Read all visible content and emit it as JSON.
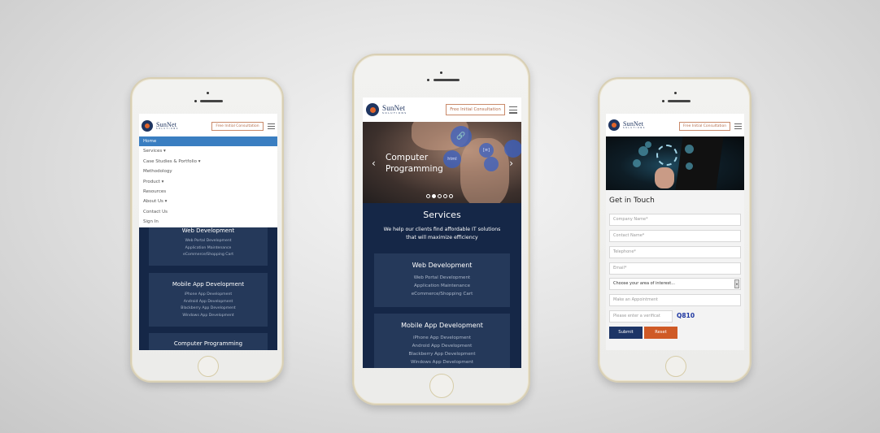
{
  "brand": {
    "name": "SunNet",
    "subtitle": "SOLUTIONS",
    "cta_label": "Free Initial Consultation",
    "colors": {
      "navy": "#152747",
      "card": "#25395a",
      "orange": "#cf5a26",
      "menu_active": "#3a7ec1"
    }
  },
  "left_phone": {
    "menu": [
      {
        "label": "Home",
        "active": true
      },
      {
        "label": "Services ▾"
      },
      {
        "label": "Case Studies & Portfolio ▾"
      },
      {
        "label": "Methodology"
      },
      {
        "label": "Product ▾"
      },
      {
        "label": "Resources"
      },
      {
        "label": "About Us ▾"
      },
      {
        "label": "Contact Us"
      },
      {
        "label": "Sign In"
      }
    ],
    "cards": [
      {
        "title": "Web Development",
        "lines": [
          "Web Portal Development",
          "Application Maintenance",
          "eCommerce/Shopping Cart"
        ]
      },
      {
        "title": "Mobile App Development",
        "lines": [
          "iPhone App Development",
          "Android App Development",
          "Blackberry App Development",
          "Windows App Development"
        ]
      },
      {
        "title": "Computer Programming",
        "lines": []
      }
    ]
  },
  "center_phone": {
    "hero": {
      "title_line1": "Computer",
      "title_line2": "Programming",
      "prev_icon": "‹",
      "next_icon": "›",
      "slide_count": 5,
      "active_slide": 2,
      "bubble_labels": [
        "🔗",
        "html",
        "[≡]",
        "",
        ""
      ]
    },
    "services": {
      "title": "Services",
      "subtitle_line1": "We help our clients find affordable IT solutions",
      "subtitle_line2": "that will maximize efficiency"
    },
    "cards": [
      {
        "title": "Web Development",
        "lines": [
          "Web Portal Development",
          "Application Maintenance",
          "eCommerce/Shopping Cart"
        ]
      },
      {
        "title": "Mobile App Development",
        "lines": [
          "iPhone App Development",
          "Android App Development",
          "Blackberry App Development",
          "Windows App Development"
        ]
      }
    ]
  },
  "right_phone": {
    "form_title": "Get in Touch",
    "fields": [
      {
        "placeholder": "Company Name*"
      },
      {
        "placeholder": "Contact Name*"
      },
      {
        "placeholder": "Telephone*"
      },
      {
        "placeholder": "Email*"
      }
    ],
    "interest_select": {
      "value": "Choose your area of interest..."
    },
    "appointment": {
      "placeholder": "Make an Appointment"
    },
    "verification": {
      "placeholder": "Please enter a verificat",
      "code": "Q810"
    },
    "submit_label": "Submit",
    "reset_label": "Reset"
  }
}
